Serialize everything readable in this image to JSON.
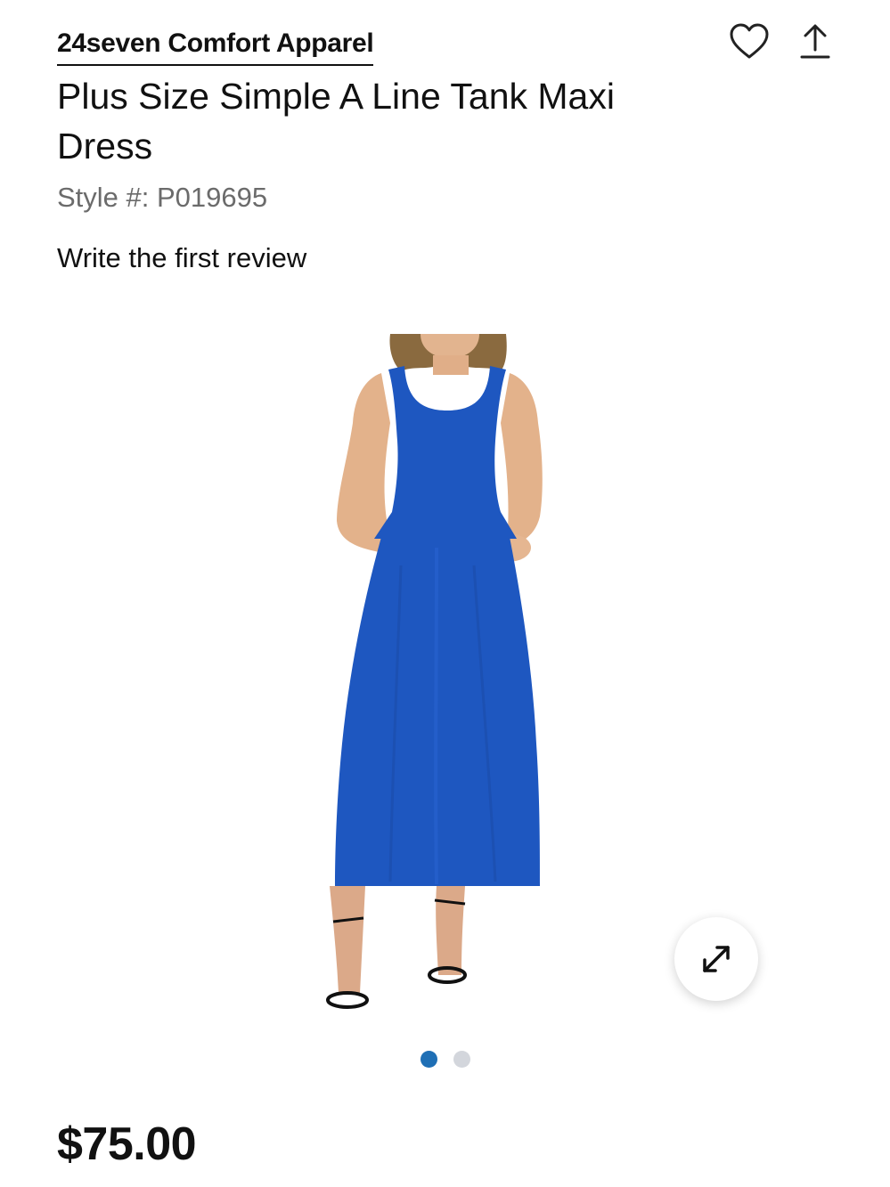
{
  "product": {
    "brand": "24seven Comfort Apparel",
    "title": "Plus Size Simple A Line Tank Maxi Dress",
    "style_label": "Style #: P019695",
    "review_link": "Write the first review",
    "price": "$75.00"
  },
  "actions": {
    "favorite_icon": "heart-icon",
    "share_icon": "share-icon",
    "zoom_icon": "expand-icon"
  },
  "gallery": {
    "image_alt": "Blue sleeveless maxi dress",
    "dots": [
      {
        "active": true
      },
      {
        "active": false
      }
    ],
    "active_color": "#1f6fb5",
    "inactive_color": "#d3d6dc"
  },
  "colors": {
    "dress": "#1e57c0",
    "text": "#111111",
    "muted": "#6b6b6b"
  }
}
